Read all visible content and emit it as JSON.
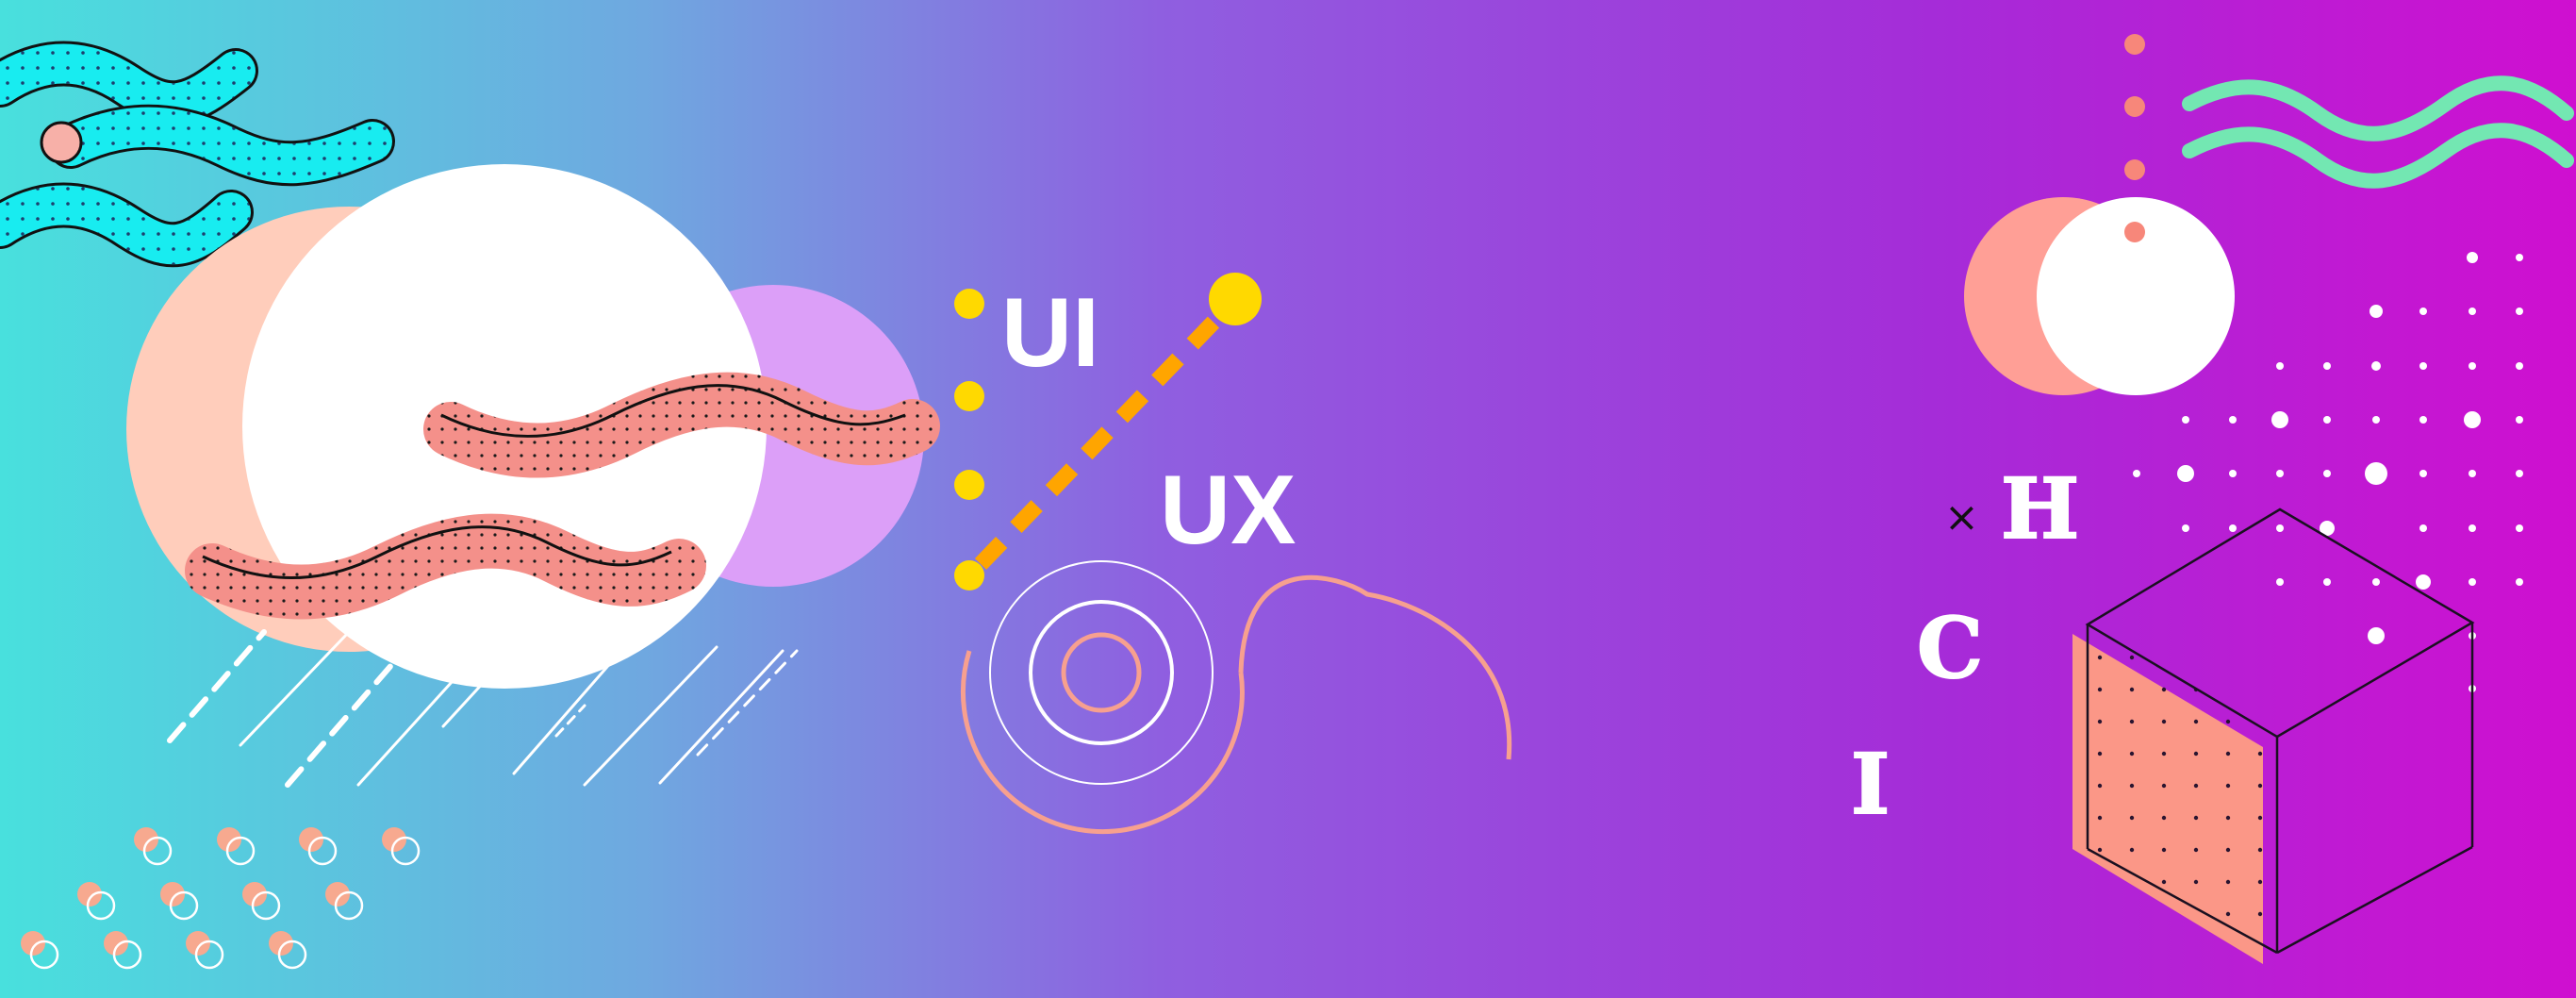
{
  "banner": {
    "ui_label": "UI",
    "ux_label": "UX",
    "hci": {
      "times_symbol": "×",
      "letters": [
        "H",
        "C",
        "I"
      ]
    }
  },
  "colors": {
    "gradient_left": "#48e0dd",
    "gradient_mid": "#8f5fe0",
    "gradient_right": "#cf0fd0",
    "coral": "#f4908a",
    "peach": "#ffcdbb",
    "lilac": "#dc9ff8",
    "cyan_wave": "#18ecf0",
    "mint_wave": "#73e7b2",
    "yellow": "#ffd900",
    "orange_dash": "#ffa500",
    "salmon_dot": "#f7877a",
    "white": "#ffffff"
  },
  "icons": [
    "cyan-wave-icon",
    "mint-wave-icon",
    "coral-squiggle-icon",
    "concentric-circles-icon",
    "isometric-cube-icon",
    "rain-lines-icon"
  ]
}
